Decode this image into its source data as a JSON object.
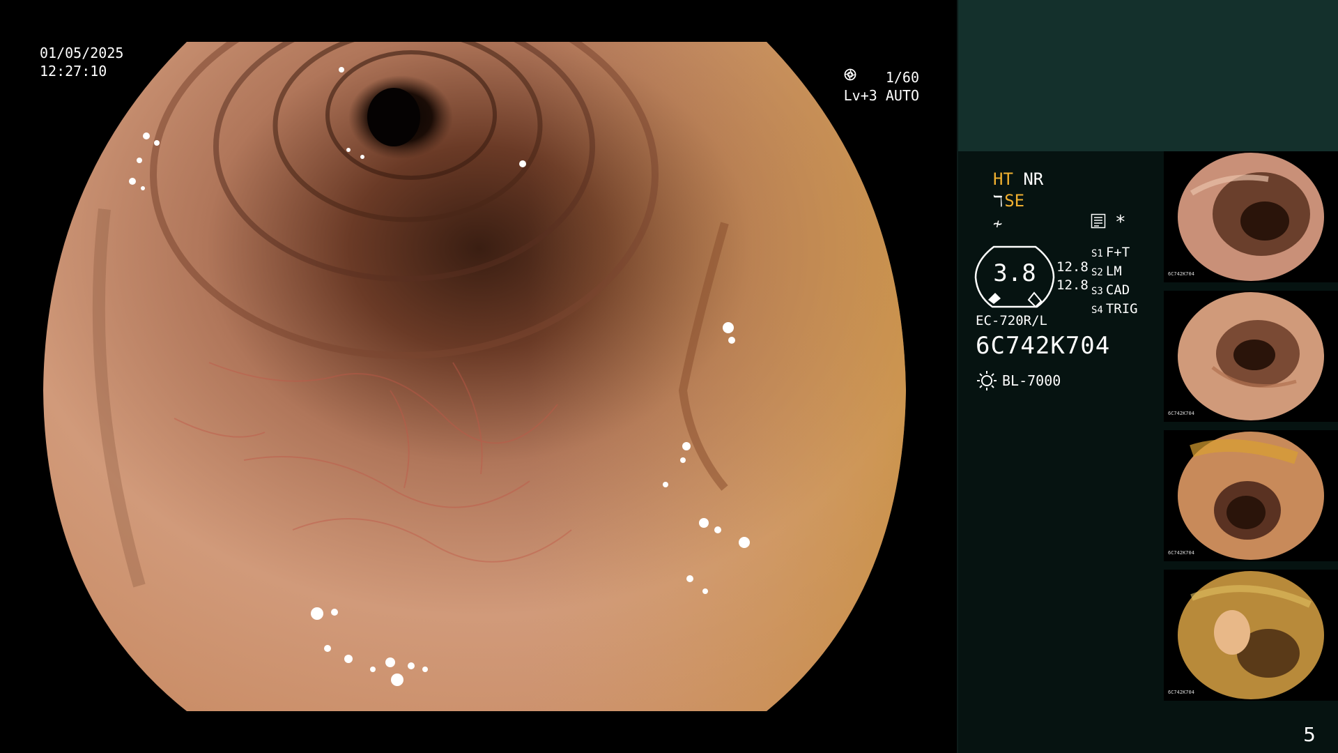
{
  "main": {
    "date": "01/05/2025",
    "time": "12:27:10",
    "shutter": "1/60",
    "level": "Lv+3 AUTO"
  },
  "panel": {
    "mode_ht": "HT",
    "mode_nr": "NR",
    "mode_se": "SE",
    "star": "*",
    "gauge_value": "3.8",
    "scale_top": "12.8",
    "scale_bottom": "12.8",
    "slots": [
      {
        "key": "S1",
        "value": "F+T"
      },
      {
        "key": "S2",
        "value": "LM"
      },
      {
        "key": "S3",
        "value": "CAD"
      },
      {
        "key": "S4",
        "value": "TRIG"
      }
    ],
    "scope_model": "EC-720R/L",
    "serial": "6C742K704",
    "light_source": "BL-7000"
  },
  "thumbnails": [
    {
      "label": "6C742K704"
    },
    {
      "label": "6C742K704"
    },
    {
      "label": "6C742K704"
    },
    {
      "label": "6C742K704"
    }
  ],
  "page_number": "5",
  "colors": {
    "panel_top": "#14302c",
    "panel_bottom": "#061311",
    "accent_yellow": "#f0b030"
  }
}
